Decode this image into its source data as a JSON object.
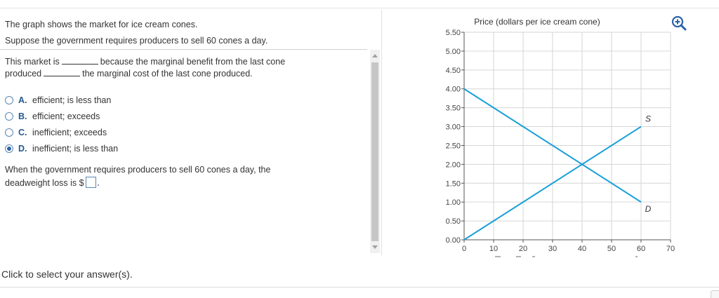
{
  "intro": {
    "line1": "The graph shows the market for ice cream cones.",
    "line2": "Suppose the government requires producers to sell 60 cones a day."
  },
  "question1": {
    "part1": "This market is",
    "part2": "because the marginal benefit from the last cone",
    "part3": "produced",
    "part4": "the marginal cost of the last cone produced."
  },
  "options": [
    {
      "letter": "A.",
      "text": "efficient; is less than",
      "selected": false
    },
    {
      "letter": "B.",
      "text": "efficient; exceeds",
      "selected": false
    },
    {
      "letter": "C.",
      "text": "inefficient; exceeds",
      "selected": false
    },
    {
      "letter": "D.",
      "text": "inefficient; is less than",
      "selected": true
    }
  ],
  "question2": {
    "line1": "When the government requires producers to sell 60 cones a day, the",
    "line2": "deadweight loss is $",
    "answer_value": ""
  },
  "status_text": "Click to select your answer(s).",
  "colors": {
    "curve": "#1a9fd8",
    "accent": "#2a63a8",
    "grid": "#d6d6d6"
  },
  "icons": {
    "zoom": "zoom-in-icon"
  },
  "chart_data": {
    "type": "line",
    "ylabel": "Price (dollars per ice cream cone)",
    "xlim": [
      0,
      70
    ],
    "ylim": [
      0,
      5.5
    ],
    "x_ticks": [
      "0",
      "10",
      "20",
      "30",
      "40",
      "50",
      "60",
      "70"
    ],
    "y_ticks": [
      "0.00",
      "0.50",
      "1.00",
      "1.50",
      "2.00",
      "2.50",
      "3.00",
      "3.50",
      "4.00",
      "4.50",
      "5.00",
      "5.50"
    ],
    "grid": true,
    "series": [
      {
        "name": "S",
        "points": [
          [
            0,
            0.0
          ],
          [
            60,
            3.0
          ]
        ]
      },
      {
        "name": "D",
        "points": [
          [
            0,
            4.0
          ],
          [
            60,
            1.0
          ]
        ]
      }
    ]
  }
}
